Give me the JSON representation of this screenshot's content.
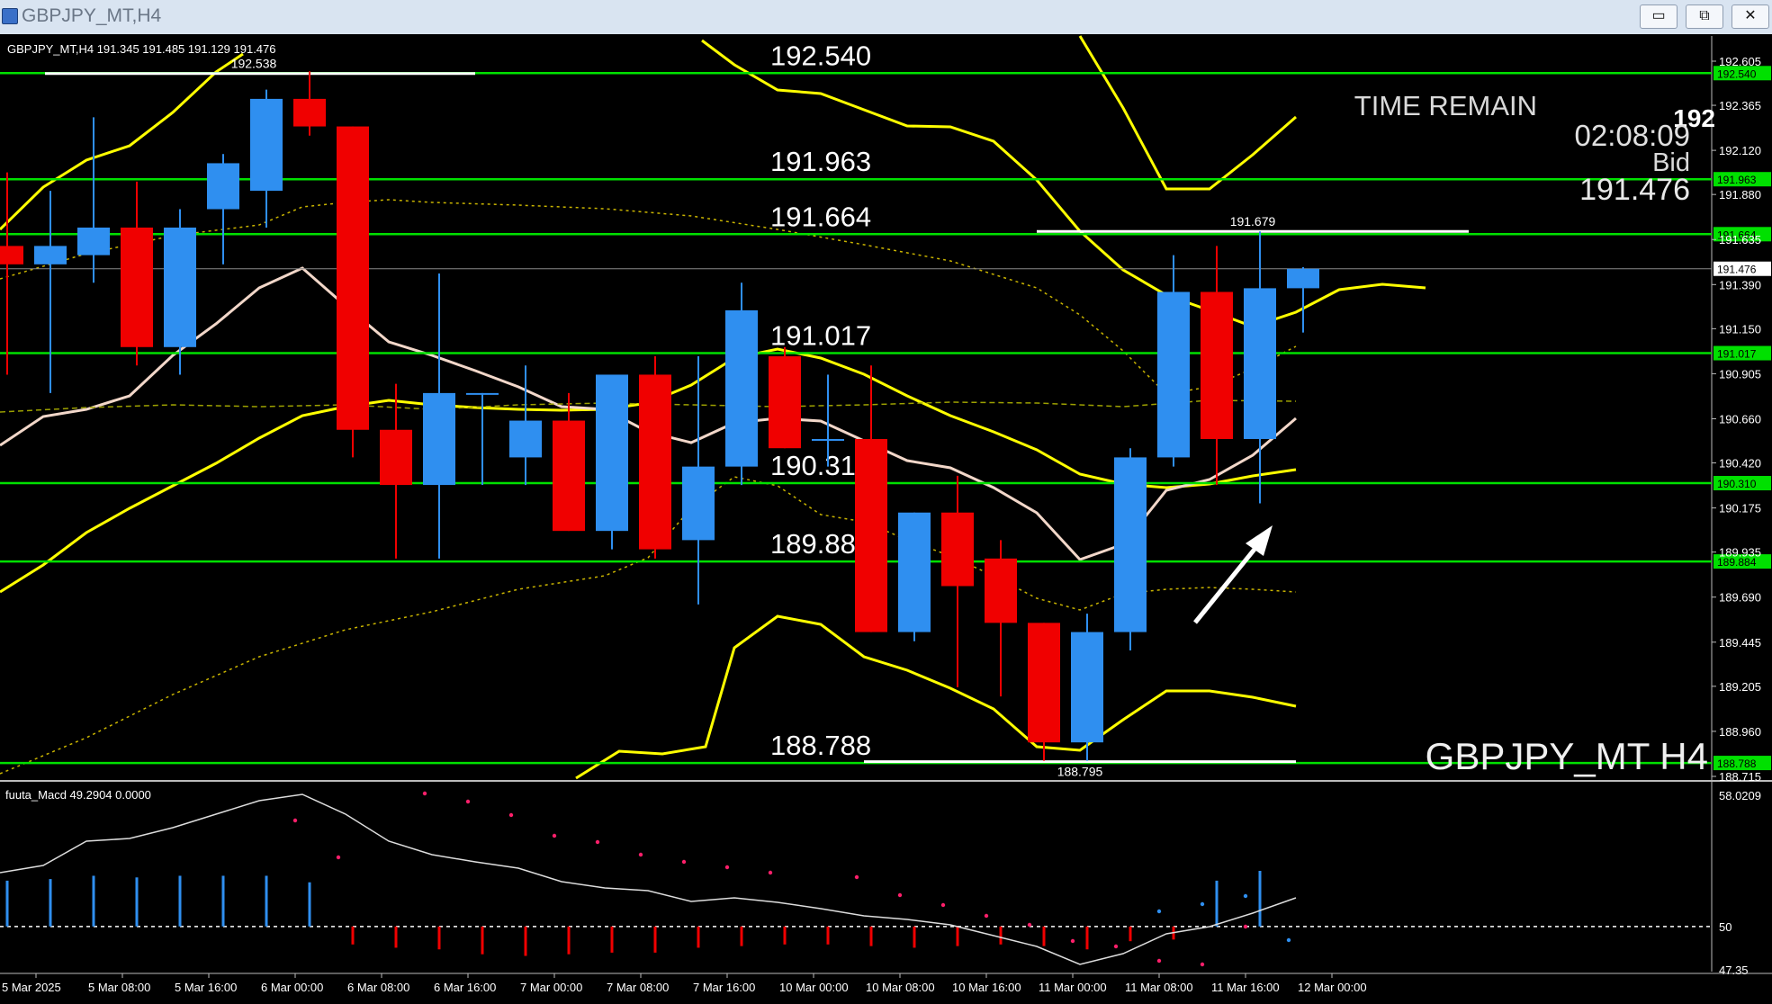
{
  "window": {
    "title": "GBPJPY_MT,H4",
    "minimize_label": "▭",
    "restore_label": "⧉",
    "close_label": "✕"
  },
  "colors": {
    "bull": "#2f8ff0",
    "bear": "#f00000",
    "level": "#00e000",
    "band": "#ffff00",
    "ma": "#f2d7c9",
    "mid": "#c9b400",
    "macd_pos": "#2f8ff0",
    "macd_neg": "#f00000",
    "signal_pos": "#2f8ff0",
    "signal_neg": "#ff1f6a"
  },
  "info": {
    "symbol_line": "GBPJPY_MT,H4  191.345 191.485 191.129 191.476",
    "time_remain_label": "TIME REMAIN",
    "time_remain_value": "02:08:09",
    "bid_label": "Bid",
    "bid_value": "191.476",
    "clipped_price": "192",
    "watermark": "GBPJPY_MT H4"
  },
  "macd": {
    "header": "fuuta_Macd 49.2904   0.0000",
    "axis": [
      "58.0209",
      "50",
      "47.35"
    ],
    "zero": 50,
    "min": 47.35,
    "max": 58.0209,
    "hist": [
      52.8,
      52.9,
      53.1,
      53.0,
      53.1,
      53.1,
      53.1,
      52.7,
      48.9,
      48.7,
      48.6,
      48.3,
      48.2,
      48.3,
      48.4,
      48.4,
      48.7,
      48.8,
      48.9,
      48.9,
      48.8,
      48.7,
      48.8,
      48.9,
      48.8,
      48.6,
      49.1,
      49.2,
      52.8,
      53.4
    ]
  },
  "chart_data": {
    "type": "candlestick",
    "price_axis_ticks": [
      "192.605",
      "192.365",
      "192.120",
      "191.880",
      "191.635",
      "191.390",
      "191.150",
      "190.905",
      "190.660",
      "190.420",
      "190.175",
      "189.935",
      "189.690",
      "189.445",
      "189.205",
      "188.960",
      "188.715"
    ],
    "price_range": [
      188.715,
      192.605
    ],
    "time_labels": [
      "5 Mar 2025",
      "5 Mar 08:00",
      "5 Mar 16:00",
      "6 Mar 00:00",
      "6 Mar 08:00",
      "6 Mar 16:00",
      "7 Mar 00:00",
      "7 Mar 08:00",
      "7 Mar 16:00",
      "10 Mar 00:00",
      "10 Mar 08:00",
      "10 Mar 16:00",
      "11 Mar 00:00",
      "11 Mar 08:00",
      "11 Mar 16:00",
      "12 Mar 00:00"
    ],
    "levels": [
      {
        "price": 192.54,
        "label": "192.540"
      },
      {
        "price": 191.963,
        "label": "191.963"
      },
      {
        "price": 191.664,
        "label": "191.664"
      },
      {
        "price": 191.017,
        "label": "191.017"
      },
      {
        "price": 190.31,
        "label": "190.310"
      },
      {
        "price": 189.884,
        "label": "189.884"
      },
      {
        "price": 188.788,
        "label": "188.788"
      }
    ],
    "current_price": "191.476",
    "annotations": [
      {
        "text": "192.538",
        "price": 192.538
      },
      {
        "text": "191.679",
        "price": 191.679
      },
      {
        "text": "188.795",
        "price": 188.795
      }
    ],
    "candles": [
      {
        "o": 191.6,
        "h": 192.0,
        "l": 190.9,
        "c": 191.5
      },
      {
        "o": 191.5,
        "h": 191.9,
        "l": 190.8,
        "c": 191.6
      },
      {
        "o": 191.55,
        "h": 192.3,
        "l": 191.4,
        "c": 191.7
      },
      {
        "o": 191.7,
        "h": 191.95,
        "l": 190.95,
        "c": 191.05
      },
      {
        "o": 191.05,
        "h": 191.8,
        "l": 190.9,
        "c": 191.7
      },
      {
        "o": 191.8,
        "h": 192.1,
        "l": 191.5,
        "c": 192.05
      },
      {
        "o": 191.9,
        "h": 192.45,
        "l": 191.7,
        "c": 192.4
      },
      {
        "o": 192.4,
        "h": 192.55,
        "l": 192.2,
        "c": 192.25
      },
      {
        "o": 192.25,
        "h": 192.25,
        "l": 190.45,
        "c": 190.6
      },
      {
        "o": 190.6,
        "h": 190.85,
        "l": 189.9,
        "c": 190.3
      },
      {
        "o": 190.3,
        "h": 191.45,
        "l": 189.9,
        "c": 190.8
      },
      {
        "o": 190.8,
        "h": 190.8,
        "l": 190.3,
        "c": 190.8
      },
      {
        "o": 190.45,
        "h": 190.95,
        "l": 190.3,
        "c": 190.65
      },
      {
        "o": 190.65,
        "h": 190.8,
        "l": 190.05,
        "c": 190.05
      },
      {
        "o": 190.05,
        "h": 190.8,
        "l": 189.95,
        "c": 190.9
      },
      {
        "o": 190.9,
        "h": 191.0,
        "l": 189.9,
        "c": 189.95
      },
      {
        "o": 190.0,
        "h": 191.0,
        "l": 189.65,
        "c": 190.4
      },
      {
        "o": 190.4,
        "h": 191.4,
        "l": 190.3,
        "c": 191.25
      },
      {
        "o": 191.0,
        "h": 191.05,
        "l": 190.5,
        "c": 190.5
      },
      {
        "o": 190.55,
        "h": 190.9,
        "l": 190.4,
        "c": 190.55
      },
      {
        "o": 190.55,
        "h": 190.95,
        "l": 189.5,
        "c": 189.5
      },
      {
        "o": 189.5,
        "h": 190.15,
        "l": 189.45,
        "c": 190.15
      },
      {
        "o": 190.15,
        "h": 190.35,
        "l": 189.2,
        "c": 189.75
      },
      {
        "o": 189.9,
        "h": 190.0,
        "l": 189.15,
        "c": 189.55
      },
      {
        "o": 189.55,
        "h": 189.55,
        "l": 188.8,
        "c": 188.9
      },
      {
        "o": 188.9,
        "h": 189.6,
        "l": 188.8,
        "c": 189.5
      },
      {
        "o": 189.5,
        "h": 190.5,
        "l": 189.4,
        "c": 190.45
      },
      {
        "o": 190.45,
        "h": 191.55,
        "l": 190.4,
        "c": 191.35
      },
      {
        "o": 191.35,
        "h": 191.6,
        "l": 190.3,
        "c": 190.55
      },
      {
        "o": 190.55,
        "h": 191.679,
        "l": 190.2,
        "c": 191.37
      },
      {
        "o": 191.37,
        "h": 191.485,
        "l": 191.129,
        "c": 191.476
      }
    ]
  }
}
